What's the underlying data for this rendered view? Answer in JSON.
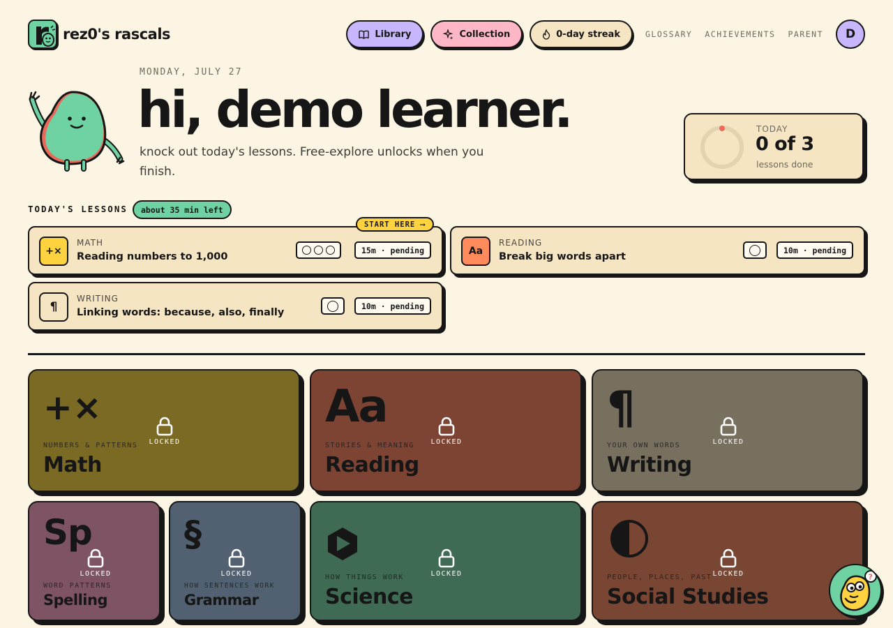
{
  "header": {
    "logo_text": "rez0's rascals",
    "nav": {
      "library": "Library",
      "collection": "Collection",
      "streak": "0-day streak",
      "glossary": "GLOSSARY",
      "achievements": "ACHIEVEMENTS",
      "parent": "PARENT"
    },
    "avatar_initial": "D"
  },
  "hero": {
    "date": "MONDAY, JULY 27",
    "greeting": "hi, demo learner.",
    "subtitle": "knock out today's lessons. Free-explore unlocks when you finish."
  },
  "today": {
    "label": "TODAY",
    "value": "0 of 3",
    "sublabel": "lessons done",
    "completed": 0,
    "total": 3
  },
  "lessons": {
    "title": "TODAY'S LESSONS",
    "time_left": "about 35 min left",
    "start_here": "START HERE ⟶",
    "items": [
      {
        "icon": "+×",
        "subject": "MATH",
        "name": "Reading numbers to 1,000",
        "duration": "15m · pending",
        "parts": 3,
        "color": "#ffd23f"
      },
      {
        "icon": "Aa",
        "subject": "READING",
        "name": "Break big words apart",
        "duration": "10m · pending",
        "parts": 1,
        "color": "#ff8a5c"
      },
      {
        "icon": "¶",
        "subject": "WRITING",
        "name": "Linking words: because, also, finally",
        "duration": "10m · pending",
        "parts": 1,
        "color": "#f5e5c3"
      }
    ]
  },
  "subjects": {
    "locked_label": "LOCKED",
    "items": [
      {
        "glyph": "+×",
        "sub": "NUMBERS & PATTERNS",
        "name": "Math",
        "color": "#7b6a24"
      },
      {
        "glyph": "Aa",
        "sub": "STORIES & MEANING",
        "name": "Reading",
        "color": "#7d4434"
      },
      {
        "glyph": "¶",
        "sub": "YOUR OWN WORDS",
        "name": "Writing",
        "color": "#77705f"
      },
      {
        "glyph": "Sp",
        "sub": "WORD PATTERNS",
        "name": "Spelling",
        "color": "#7e5464"
      },
      {
        "glyph": "§",
        "sub": "HOW SENTENCES WORK",
        "name": "Grammar",
        "color": "#516172"
      },
      {
        "glyph": "",
        "sub": "HOW THINGS WORK",
        "name": "Science",
        "color": "#3f6b54"
      },
      {
        "glyph": "",
        "sub": "PEOPLE, PLACES, PAST",
        "name": "Social Studies",
        "color": "#7a4634"
      }
    ]
  }
}
